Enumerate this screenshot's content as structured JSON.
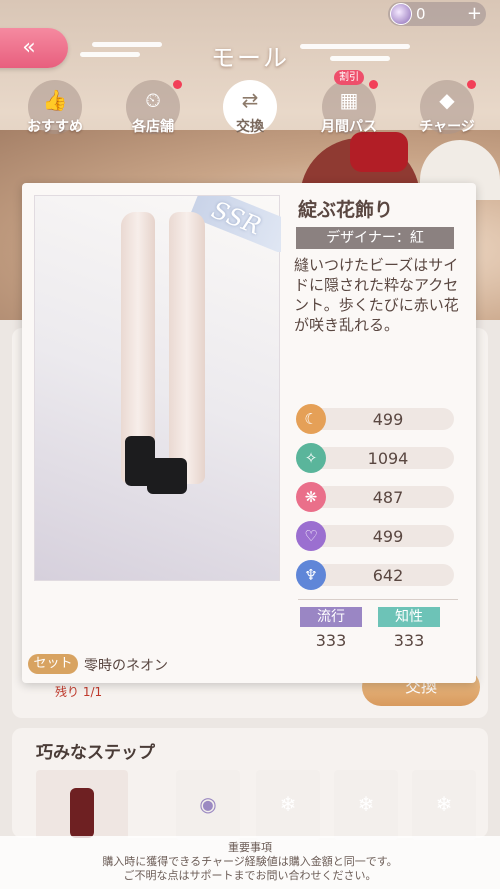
{
  "header": {
    "title": "モール",
    "currency_value": "0"
  },
  "tabs": [
    {
      "label": "おすすめ",
      "icon": "thumbs-up-icon"
    },
    {
      "label": "各店舗",
      "icon": "shop-icon"
    },
    {
      "label": "交換",
      "icon": "exchange-icon"
    },
    {
      "label": "月間パス",
      "icon": "calendar-icon",
      "badge": "割引"
    },
    {
      "label": "チャージ",
      "icon": "diamond-icon"
    }
  ],
  "item": {
    "name": "綻ぶ花飾り",
    "rarity": "SSR",
    "designer": "デザイナー：紅",
    "description": "縫いつけたビーズはサイドに隠された粋なアクセント。歩くたびに赤い花が咲き乱れる。",
    "stats": [
      {
        "icon": "elegant-icon",
        "value": "499",
        "color": "#e5a057"
      },
      {
        "icon": "fresh-icon",
        "value": "1094",
        "color": "#5ab59b"
      },
      {
        "icon": "sweet-icon",
        "value": "487",
        "color": "#ea6f8a"
      },
      {
        "icon": "sexy-icon",
        "value": "499",
        "color": "#9b6fd0"
      },
      {
        "icon": "cool-icon",
        "value": "642",
        "color": "#5f86d8"
      }
    ],
    "tags": [
      {
        "label": "流行",
        "value": "333",
        "color": "#9a86c4"
      },
      {
        "label": "知性",
        "value": "333",
        "color": "#6dc3b7"
      }
    ],
    "set_label": "セット",
    "set_name": "零時のネオン"
  },
  "list": {
    "remaining": "残り 1/1",
    "exchange_button": "交換"
  },
  "section": {
    "title": "巧みなステップ"
  },
  "notice": {
    "heading": "重要事項",
    "line1": "購入時に獲得できるチャージ経験値は購入金額と同一です。",
    "line2": "ご不明な点はサポートまでお問い合わせください。"
  }
}
